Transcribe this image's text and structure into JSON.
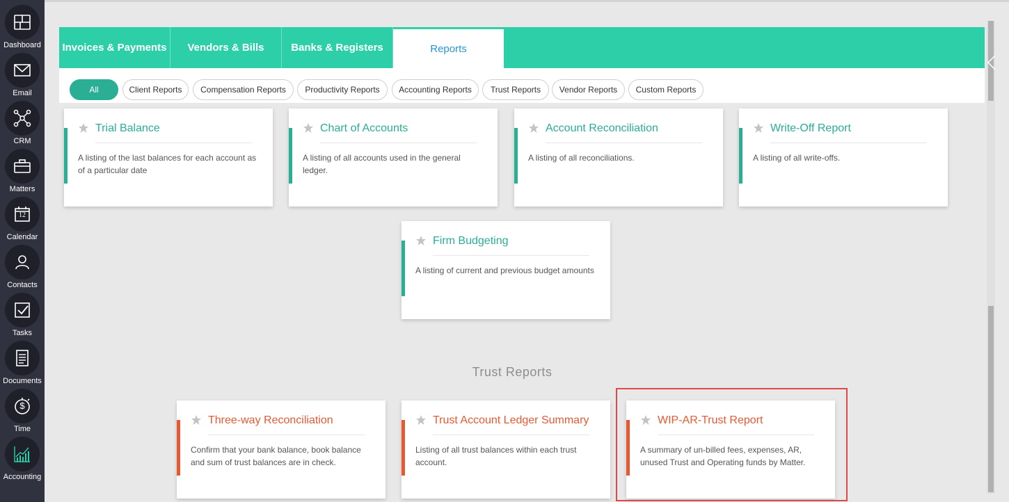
{
  "sidebar": {
    "items": [
      {
        "label": "Dashboard",
        "icon": "dashboard-icon"
      },
      {
        "label": "Email",
        "icon": "envelope-icon"
      },
      {
        "label": "CRM",
        "icon": "network-icon"
      },
      {
        "label": "Matters",
        "icon": "briefcase-icon"
      },
      {
        "label": "Calendar",
        "icon": "calendar-icon",
        "calendar_day": "12"
      },
      {
        "label": "Contacts",
        "icon": "contacts-icon"
      },
      {
        "label": "Tasks",
        "icon": "checkbox-icon"
      },
      {
        "label": "Documents",
        "icon": "document-icon"
      },
      {
        "label": "Time",
        "icon": "stopwatch-icon",
        "time_symbol": "$"
      },
      {
        "label": "Accounting",
        "icon": "chart-icon",
        "active": true
      }
    ]
  },
  "tabs": [
    {
      "label": "Invoices & Payments"
    },
    {
      "label": "Vendors & Bills"
    },
    {
      "label": "Banks & Registers"
    },
    {
      "label": "Reports",
      "active": true
    }
  ],
  "filters": [
    {
      "label": "All",
      "active": true
    },
    {
      "label": "Client Reports"
    },
    {
      "label": "Compensation Reports"
    },
    {
      "label": "Productivity Reports"
    },
    {
      "label": "Accounting Reports"
    },
    {
      "label": "Trust Reports"
    },
    {
      "label": "Vendor Reports"
    },
    {
      "label": "Custom Reports"
    }
  ],
  "accounting_cards": [
    {
      "title": "Trial Balance",
      "desc": "A listing of the last balances for each account as of a particular date"
    },
    {
      "title": "Chart of Accounts",
      "desc": "A listing of all accounts used in the general ledger."
    },
    {
      "title": "Account Reconciliation",
      "desc": "A listing of all reconciliations."
    },
    {
      "title": "Write-Off Report",
      "desc": "A listing of all write-offs."
    },
    {
      "title": "Firm Budgeting",
      "desc": "A listing of current and previous budget amounts"
    }
  ],
  "trust_section_title": "Trust Reports",
  "trust_cards": [
    {
      "title": "Three-way Reconciliation",
      "desc": "Confirm that your bank balance, book balance and sum of trust balances are in check."
    },
    {
      "title": "Trust Account Ledger Summary",
      "desc": "Listing of all trust balances within each trust account."
    },
    {
      "title": "WIP-AR-Trust Report",
      "desc": "A summary of un-billed fees, expenses, AR, unused Trust and Operating funds by Matter."
    }
  ],
  "colors": {
    "accent_green": "#2dcfa8",
    "card_green": "#2aae94",
    "card_red": "#e55a33",
    "active_tab_text": "#2596d4",
    "highlight_border": "#e04848"
  }
}
